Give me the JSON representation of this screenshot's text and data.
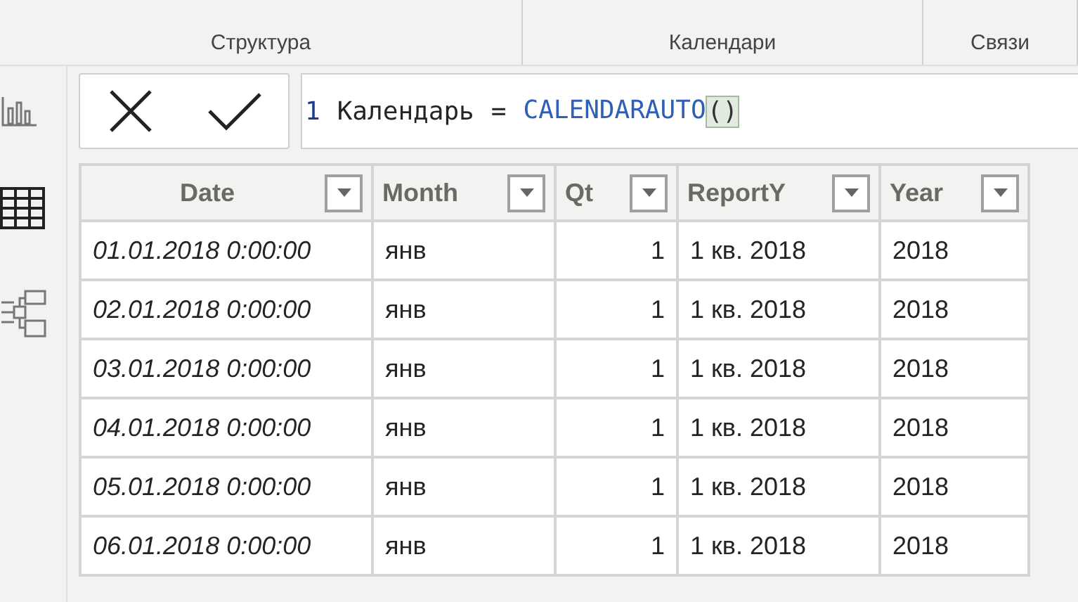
{
  "ribbon": {
    "groups": [
      "Структура",
      "Календари",
      "Связи"
    ]
  },
  "formula_bar": {
    "line_number": "1",
    "name": "Календарь",
    "operator": "=",
    "function": "CALENDARAUTO",
    "parens": "()"
  },
  "table": {
    "columns": [
      {
        "label": "Date",
        "kind": "datetime"
      },
      {
        "label": "Month",
        "kind": "text"
      },
      {
        "label": "Qt",
        "kind": "number"
      },
      {
        "label": "ReportY",
        "kind": "text"
      },
      {
        "label": "Year",
        "kind": "text"
      }
    ],
    "rows": [
      [
        "01.01.2018 0:00:00",
        "янв",
        "1",
        "1 кв. 2018",
        "2018"
      ],
      [
        "02.01.2018 0:00:00",
        "янв",
        "1",
        "1 кв. 2018",
        "2018"
      ],
      [
        "03.01.2018 0:00:00",
        "янв",
        "1",
        "1 кв. 2018",
        "2018"
      ],
      [
        "04.01.2018 0:00:00",
        "янв",
        "1",
        "1 кв. 2018",
        "2018"
      ],
      [
        "05.01.2018 0:00:00",
        "янв",
        "1",
        "1 кв. 2018",
        "2018"
      ],
      [
        "06.01.2018 0:00:00",
        "янв",
        "1",
        "1 кв. 2018",
        "2018"
      ]
    ]
  }
}
